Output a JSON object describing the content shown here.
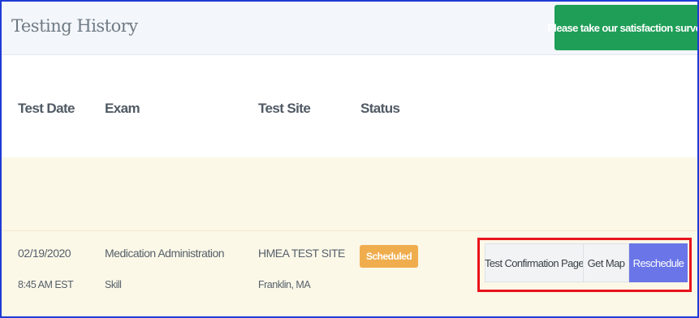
{
  "header": {
    "title": "Testing History",
    "survey_button": "Please take our satisfaction survey"
  },
  "table": {
    "columns": [
      "Test Date",
      "Exam",
      "Test Site",
      "Status"
    ],
    "rows": [
      {
        "date": "02/19/2020",
        "time": "8:45 AM EST",
        "exam": "Medication Administration",
        "exam_type": "Skill",
        "site": "HMEA TEST SITE",
        "location": "Franklin, MA",
        "status": "Scheduled",
        "actions": [
          "Test Confirmation Page",
          "Get Map",
          "Reschedule"
        ]
      }
    ]
  },
  "colors": {
    "survey_button": "#1f9e57",
    "status_badge": "#f0ad4e",
    "primary_button": "#6a75e8",
    "highlight_border": "#e8131c",
    "row_background": "#fcf8e8"
  }
}
